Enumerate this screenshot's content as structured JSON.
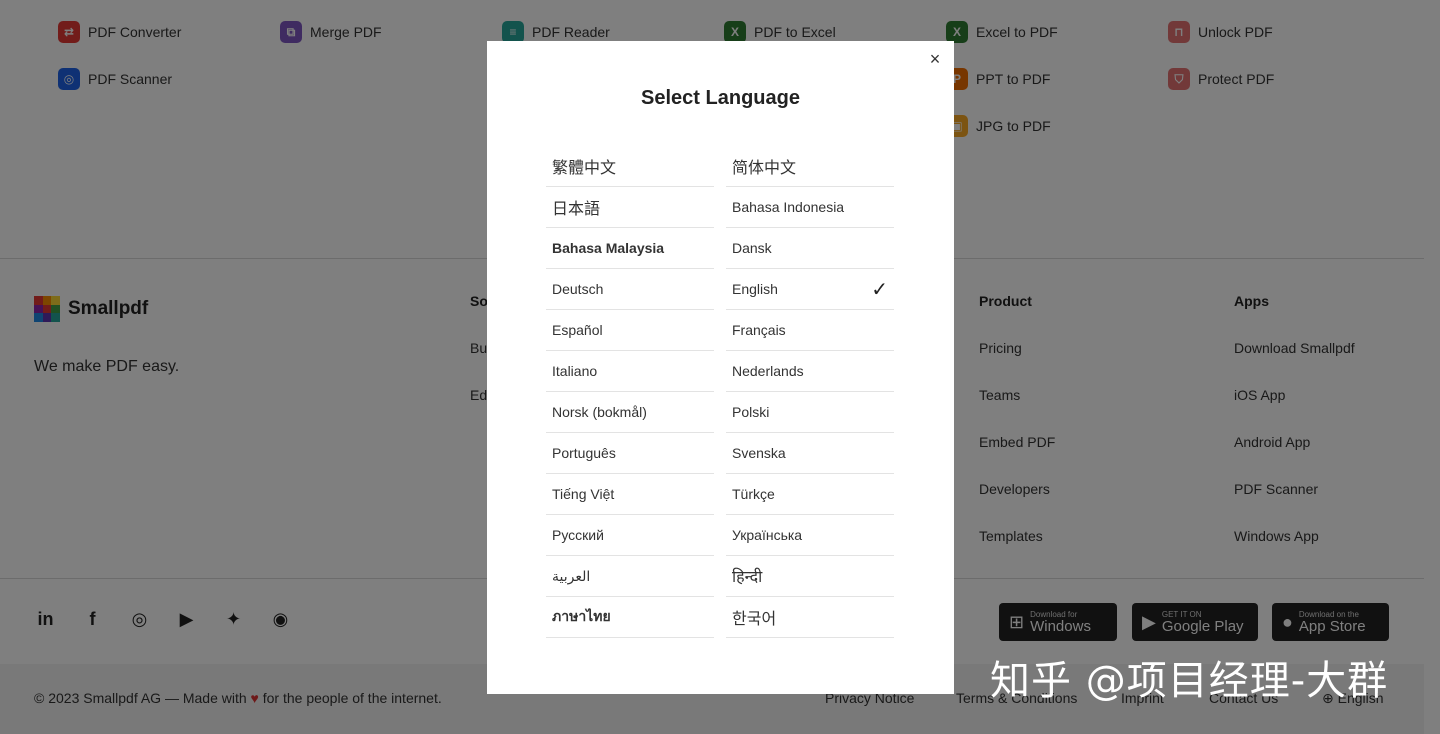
{
  "tools": [
    {
      "label": "PDF Converter",
      "icon": "pdf-converter-icon",
      "color": "#e53935",
      "glyph": "⇄"
    },
    {
      "label": "Merge PDF",
      "icon": "merge-pdf-icon",
      "color": "#7e57c2",
      "glyph": "⧉"
    },
    {
      "label": "PDF Reader",
      "icon": "pdf-reader-icon",
      "color": "#26a69a",
      "glyph": "≡"
    },
    {
      "label": "PDF to Excel",
      "icon": "pdf-to-excel-icon",
      "color": "#2e7d32",
      "glyph": "X"
    },
    {
      "label": "Excel to PDF",
      "icon": "excel-to-pdf-icon",
      "color": "#2e7d32",
      "glyph": "X"
    },
    {
      "label": "Unlock PDF",
      "icon": "unlock-pdf-icon",
      "color": "#e57373",
      "glyph": "🔓"
    },
    {
      "label": "PDF Scanner",
      "icon": "pdf-scanner-icon",
      "color": "#1e63e9",
      "glyph": "◎"
    },
    {
      "label": "PPT to PDF",
      "icon": "ppt-to-pdf-icon",
      "color": "#ef6c00",
      "glyph": "P"
    },
    {
      "label": "Protect PDF",
      "icon": "protect-pdf-icon",
      "color": "#e57373",
      "glyph": "⛉"
    },
    {
      "label": "JPG to PDF",
      "icon": "jpg-to-pdf-icon",
      "color": "#f9a825",
      "glyph": "▣"
    }
  ],
  "brand": {
    "name": "Smallpdf",
    "tagline": "We make PDF easy."
  },
  "columns": {
    "solutions": {
      "heading": "So",
      "links": [
        "Bu",
        "Ed"
      ]
    },
    "product": {
      "heading": "Product",
      "links": [
        "Pricing",
        "Teams",
        "Embed PDF",
        "Developers",
        "Templates"
      ]
    },
    "apps": {
      "heading": "Apps",
      "links": [
        "Download Smallpdf",
        "iOS App",
        "Android App",
        "PDF Scanner",
        "Windows App"
      ]
    }
  },
  "socials": [
    "linkedin-icon",
    "facebook-icon",
    "instagram-icon",
    "youtube-icon",
    "twitter-icon",
    "spotify-icon"
  ],
  "stores": [
    {
      "small": "Download for",
      "big": "Windows",
      "icon": "windows-icon"
    },
    {
      "small": "GET IT ON",
      "big": "Google Play",
      "icon": "google-play-icon"
    },
    {
      "small": "Download on the",
      "big": "App Store",
      "icon": "apple-icon"
    }
  ],
  "footer": {
    "copyright_pre": "© 2023 Smallpdf AG — Made with",
    "copyright_post": "for the people of the internet.",
    "links": [
      "Privacy Notice",
      "Terms & Conditions",
      "Imprint",
      "Contact Us"
    ],
    "language": "English"
  },
  "modal": {
    "title": "Select Language",
    "close": "×",
    "languages": [
      {
        "label": "繁體中文",
        "selected": false
      },
      {
        "label": "简体中文",
        "selected": false
      },
      {
        "label": "日本語",
        "selected": false
      },
      {
        "label": "Bahasa Indonesia",
        "selected": false
      },
      {
        "label": "Bahasa Malaysia",
        "selected": false
      },
      {
        "label": "Dansk",
        "selected": false
      },
      {
        "label": "Deutsch",
        "selected": false
      },
      {
        "label": "English",
        "selected": true
      },
      {
        "label": "Español",
        "selected": false
      },
      {
        "label": "Français",
        "selected": false
      },
      {
        "label": "Italiano",
        "selected": false
      },
      {
        "label": "Nederlands",
        "selected": false
      },
      {
        "label": "Norsk (bokmål)",
        "selected": false
      },
      {
        "label": "Polski",
        "selected": false
      },
      {
        "label": "Português",
        "selected": false
      },
      {
        "label": "Svenska",
        "selected": false
      },
      {
        "label": "Tiếng Việt",
        "selected": false
      },
      {
        "label": "Türkçe",
        "selected": false
      },
      {
        "label": "Русский",
        "selected": false
      },
      {
        "label": "Українська",
        "selected": false
      },
      {
        "label": "العربية",
        "selected": false
      },
      {
        "label": "हिन्दी",
        "selected": false
      },
      {
        "label": "ภาษาไทย",
        "selected": false
      },
      {
        "label": "한국어",
        "selected": false
      }
    ]
  },
  "watermark": "知乎 @项目经理-大群"
}
